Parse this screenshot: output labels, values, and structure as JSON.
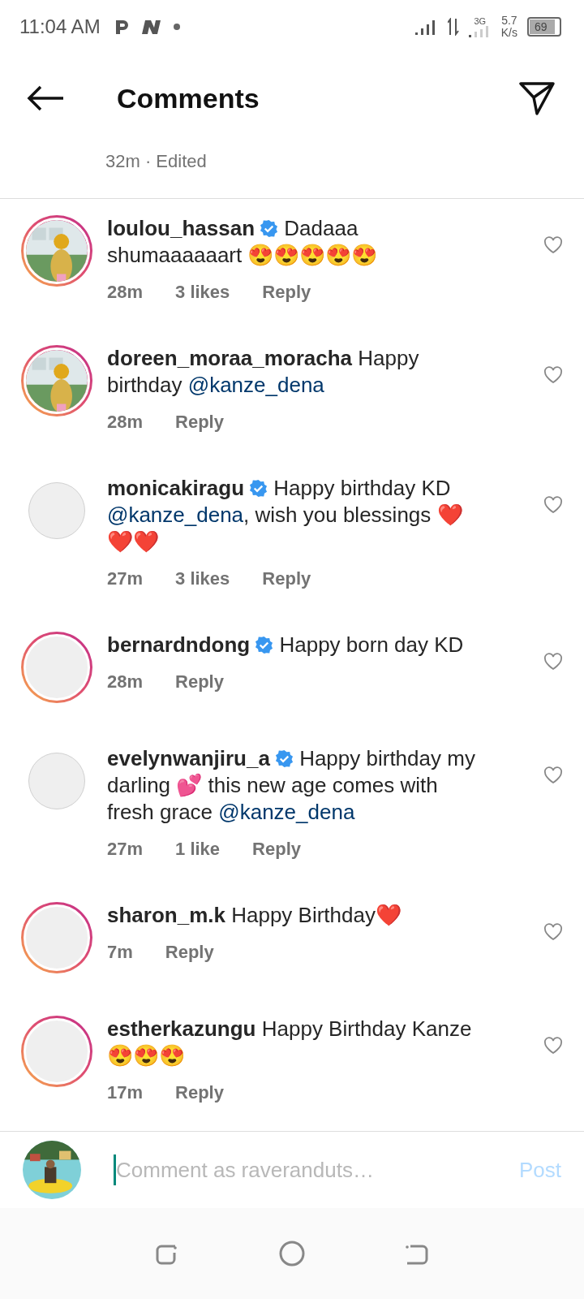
{
  "status_bar": {
    "time": "11:04 AM",
    "network": "3G",
    "speed_value": "5.7",
    "speed_unit": "K/s",
    "battery": "69"
  },
  "header": {
    "title": "Comments"
  },
  "caption_meta": "32m · Edited",
  "comments": [
    {
      "username": "loulou_hassan",
      "verified": true,
      "ring": true,
      "has_photo": true,
      "parts": [
        {
          "kind": "plain",
          "text": "Dadaaa shumaaaaaart 😍😍😍😍😍"
        }
      ],
      "time": "28m",
      "likes": "3 likes",
      "reply": "Reply"
    },
    {
      "username": "doreen_moraa_moracha",
      "verified": false,
      "ring": true,
      "has_photo": true,
      "parts": [
        {
          "kind": "plain",
          "text": "Happy birthday "
        },
        {
          "kind": "mention",
          "text": "@kanze_dena"
        }
      ],
      "time": "28m",
      "reply": "Reply"
    },
    {
      "username": "monicakiragu",
      "verified": true,
      "ring": false,
      "has_photo": false,
      "parts": [
        {
          "kind": "plain",
          "text": "Happy birthday KD "
        },
        {
          "kind": "mention",
          "text": "@kanze_dena"
        },
        {
          "kind": "plain",
          "text": ", wish you blessings ❤️❤️❤️"
        }
      ],
      "time": "27m",
      "likes": "3 likes",
      "reply": "Reply"
    },
    {
      "username": "bernardndong",
      "verified": true,
      "ring": true,
      "has_photo": false,
      "parts": [
        {
          "kind": "plain",
          "text": "Happy born day KD"
        }
      ],
      "time": "28m",
      "reply": "Reply"
    },
    {
      "username": "evelynwanjiru_a",
      "verified": true,
      "ring": false,
      "has_photo": false,
      "parts": [
        {
          "kind": "plain",
          "text": "Happy birthday my darling 💕 this new age comes with fresh grace "
        },
        {
          "kind": "mention",
          "text": "@kanze_dena"
        }
      ],
      "time": "27m",
      "likes": "1 like",
      "reply": "Reply"
    },
    {
      "username": "sharon_m.k",
      "verified": false,
      "ring": true,
      "has_photo": false,
      "parts": [
        {
          "kind": "plain",
          "text": "Happy Birthday❤️"
        }
      ],
      "time": "7m",
      "reply": "Reply"
    },
    {
      "username": "estherkazungu",
      "verified": false,
      "ring": true,
      "has_photo": false,
      "parts": [
        {
          "kind": "plain",
          "text": "Happy Birthday Kanze 😍😍😍"
        }
      ],
      "time": "17m",
      "reply": "Reply"
    }
  ],
  "composer": {
    "placeholder": "Comment as raveranduts…",
    "post": "Post"
  }
}
